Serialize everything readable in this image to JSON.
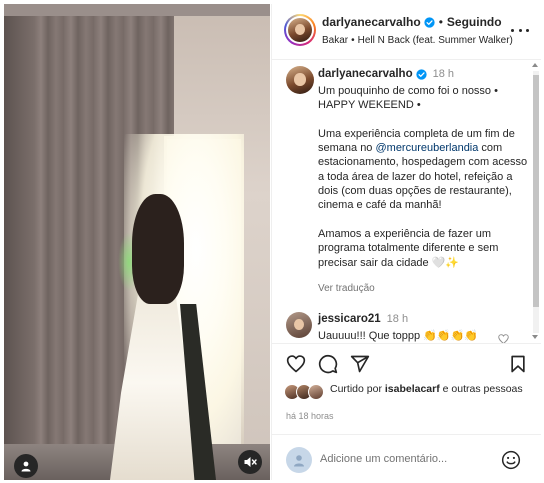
{
  "media": {
    "alt": "Video post",
    "user_icon": "user-icon",
    "mute_icon": "speaker-muted-icon"
  },
  "header": {
    "username": "darlyanecarvalho",
    "separator": "•",
    "follow_status": "Seguindo",
    "audio_artist": "Bakar",
    "audio_separator": "•",
    "audio_title": "Hell N Back (feat. Summer Walker)"
  },
  "caption": {
    "username": "darlyanecarvalho",
    "time": "18 h",
    "lines": [
      "Um pouquinho de como foi o nosso •",
      "HAPPY WEKEEND •"
    ],
    "para2_before": "Uma experiência completa de um fim de semana no ",
    "para2_mention": "@mercureuberlandia",
    "para2_after": " com estacionamento, hospedagem com acesso a toda área de lazer do hotel, refeição a dois (com duas opções de restaurante), cinema e café da manhã!",
    "para3": "Amamos a experiência de fazer um programa totalmente diferente e sem precisar sair da cidade 🤍✨",
    "see_translation": "Ver tradução"
  },
  "comment": {
    "username": "jessicaro21",
    "time": "18 h",
    "text": "Uauuuu!!! Que toppp 👏👏👏👏"
  },
  "likes": {
    "prefix": "Curtido por ",
    "user": "isabelacarf",
    "suffix": " e outras pessoas"
  },
  "post_time": "há 18 horas",
  "add_comment": {
    "placeholder": "Adicione um comentário..."
  },
  "colors": {
    "text": "#262626",
    "secondary": "#8e8e8e",
    "link": "#00376b",
    "verified": "#0095f6"
  }
}
